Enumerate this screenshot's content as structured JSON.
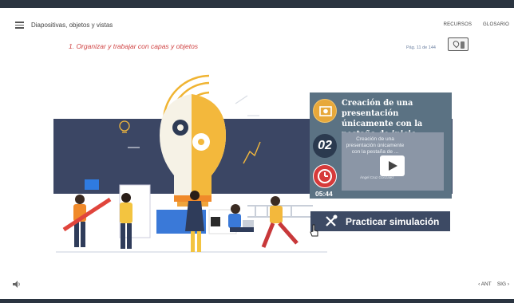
{
  "header": {
    "title": "Diapositivas, objetos y vistas",
    "menu_icon": "hamburger-menu-icon",
    "links": [
      "RECURSOS",
      "GLOSARIO"
    ]
  },
  "section": {
    "title": "1. Organizar y trabajar con capas y objetos"
  },
  "pagination": {
    "label": "Pág.",
    "current": "11",
    "separator": "de",
    "total": "144",
    "icon": "map-pin-icon"
  },
  "card": {
    "title": "Creación de una presentación únicamente con la pestaña de inicio",
    "number": "02",
    "duration": "05:44",
    "video_text": "Creación de una presentación únicamente con la pestaña de ...",
    "video_author": "Ángel Cruz Gonzalez"
  },
  "practice": {
    "label": "Practicar simulación",
    "icon": "tools-icon"
  },
  "footer": {
    "prev_label": "ANT",
    "next_label": "SIG",
    "prev_icon": "chevron-left-icon",
    "next_icon": "chevron-right-icon",
    "sound_icon": "speaker-icon"
  },
  "colors": {
    "top_bar": "#2a3440",
    "section_title": "#d04444",
    "banner": "#3b4664",
    "card_panel": "#5b7283",
    "practice_button": "#3d4a64",
    "badge_orange": "#e7a83a",
    "badge_red": "#d63a3a"
  }
}
